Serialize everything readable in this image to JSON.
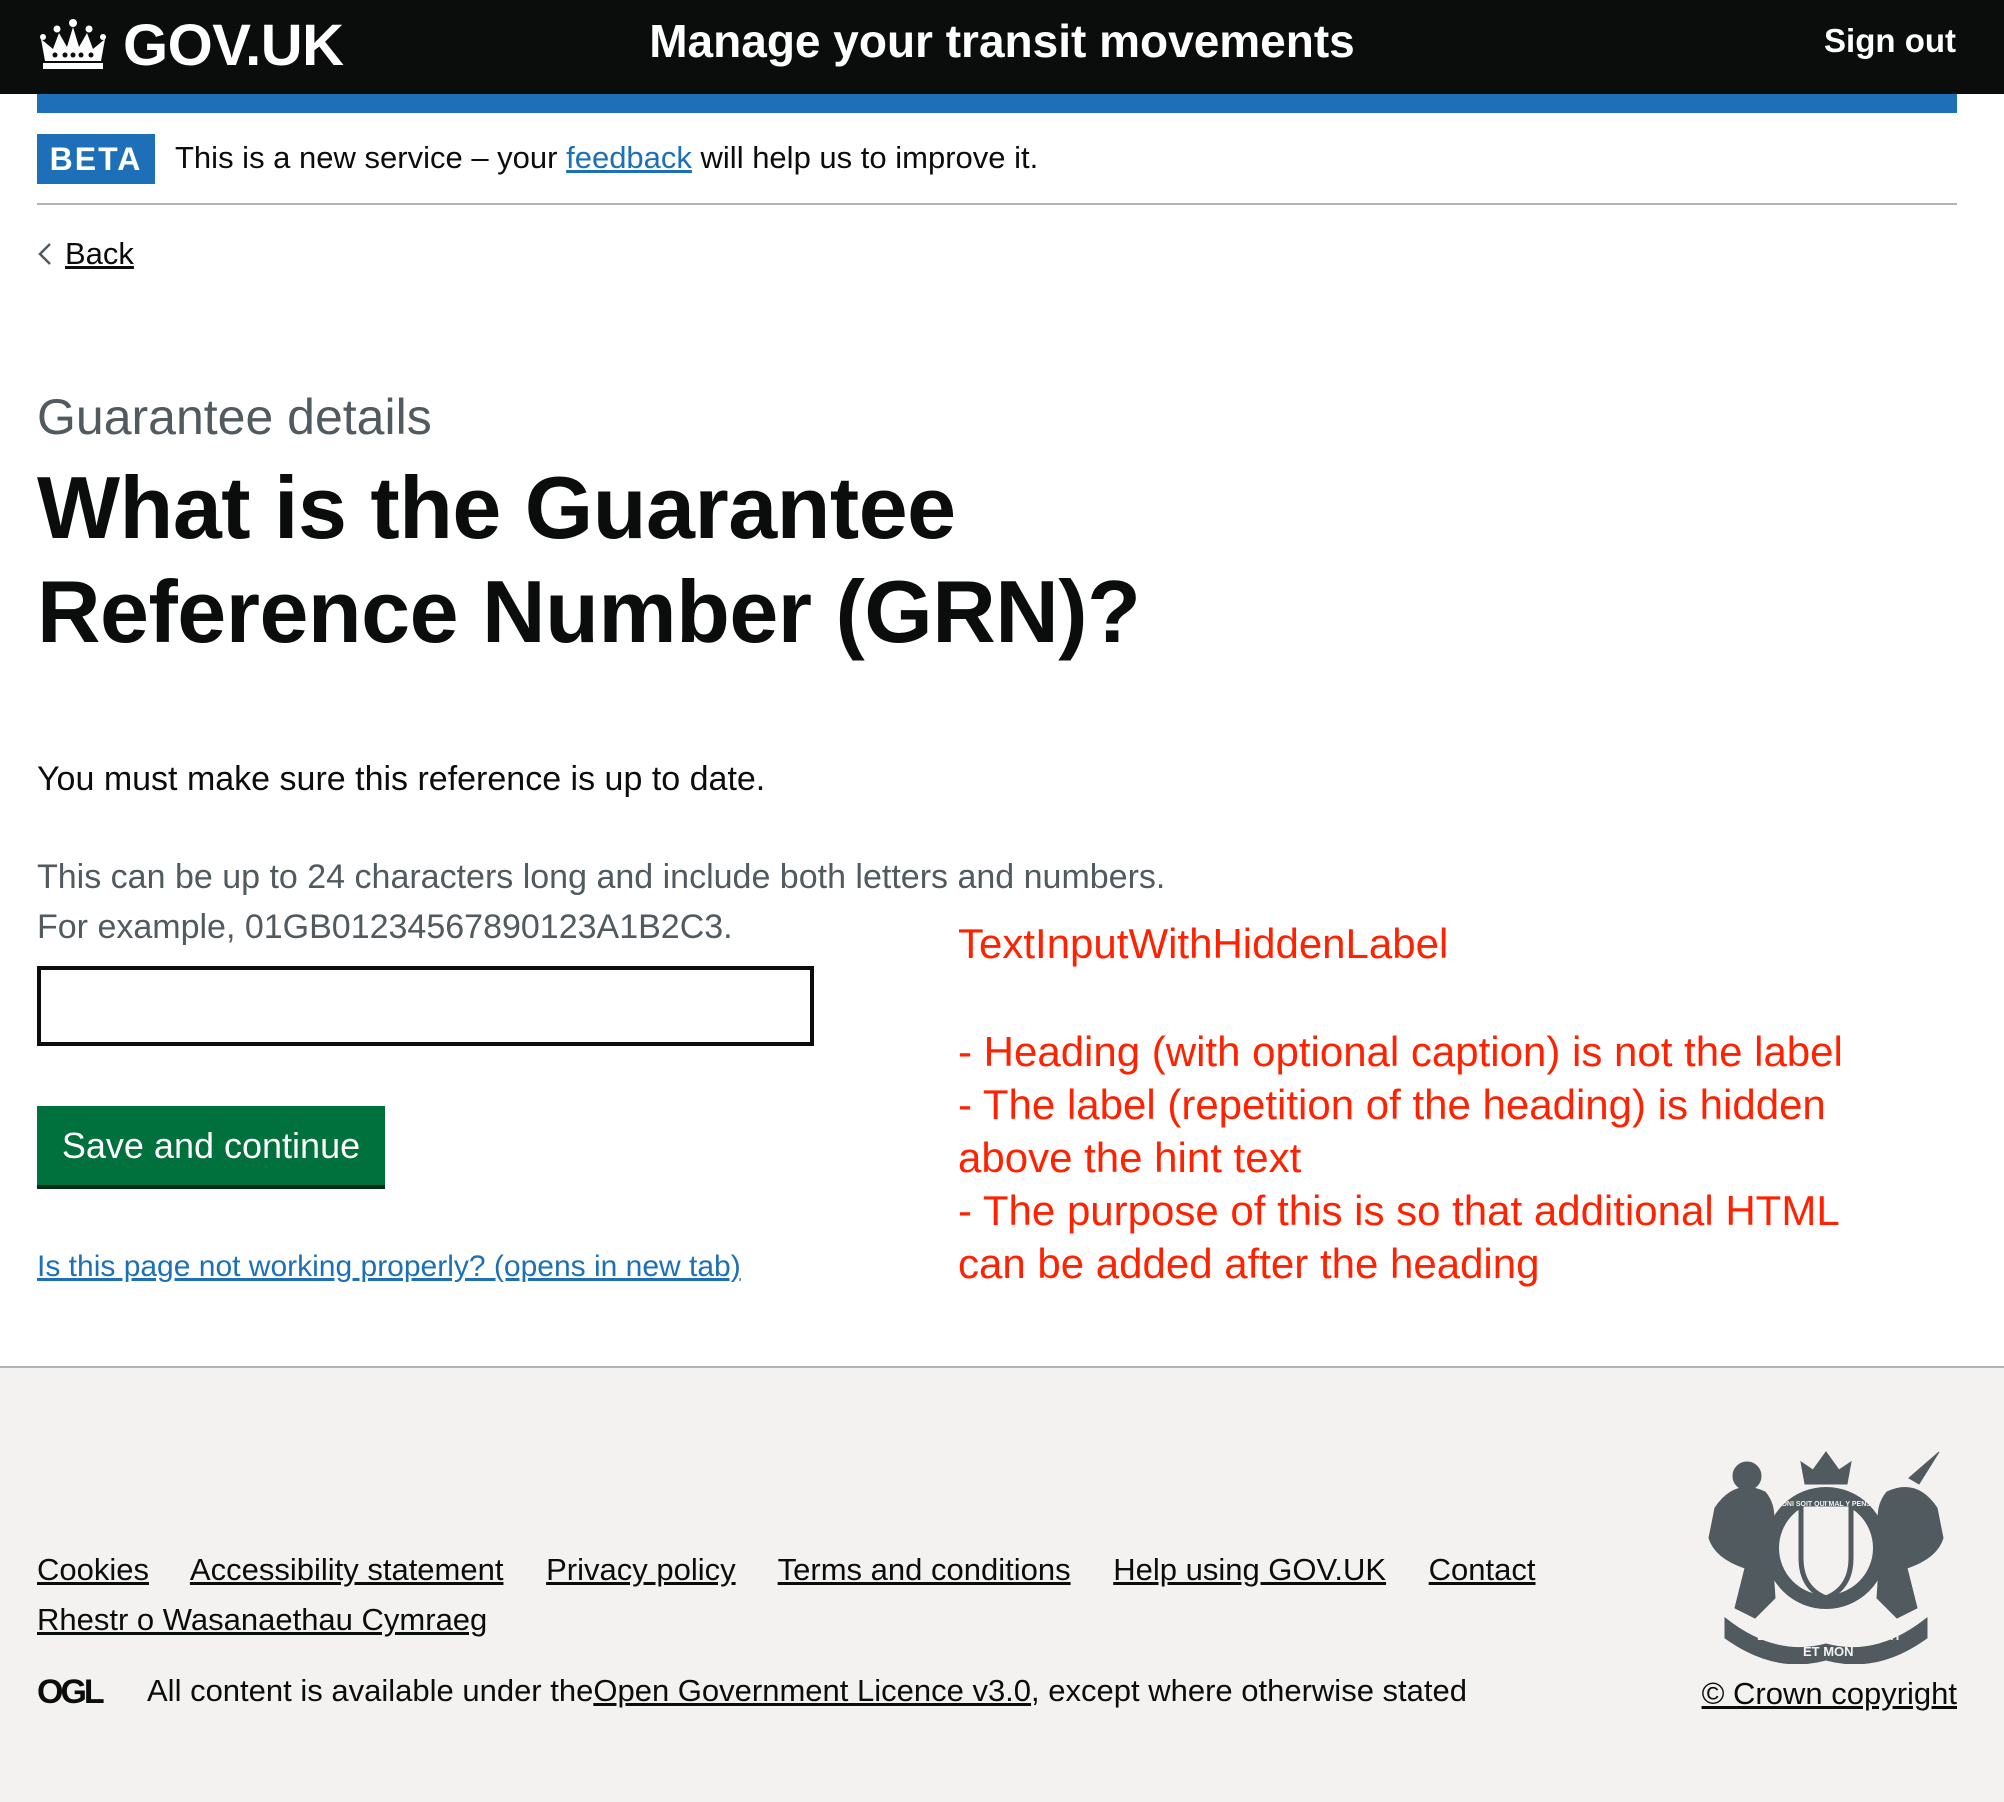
{
  "header": {
    "logo_text": "GOV.UK",
    "service_name": "Manage your transit movements",
    "sign_out": "Sign out"
  },
  "phase_banner": {
    "tag": "BETA",
    "text_before": "This is a new service – your ",
    "link_text": "feedback",
    "text_after": " will help us to improve it."
  },
  "back_link": "Back",
  "main": {
    "caption": "Guarantee details",
    "heading_line1": "What is the Guarantee",
    "heading_line2": "Reference Number (GRN)?",
    "body": "You must make sure this reference is up to date.",
    "hint_line1": "This can be up to 24 characters long and include both letters and numbers.",
    "hint_line2": "For example, 01GB01234567890123A1B2C3.",
    "input_value": "",
    "button": "Save and continue",
    "report_link": "Is this page not working properly? (opens in new tab)"
  },
  "annotation": {
    "title": "TextInputWithHiddenLabel",
    "line1": "- Heading (with optional caption) is not the label",
    "line2": "- The label (repetition of the heading) is hidden above the hint text",
    "line3": "- The purpose of this is so that additional HTML can be added after the heading"
  },
  "footer": {
    "links": [
      "Cookies",
      "Accessibility statement",
      "Privacy policy",
      "Terms and conditions",
      "Help using GOV.UK",
      "Contact",
      "Rhestr o Wasanaethau Cymraeg"
    ],
    "licence_before": "All content is available under the ",
    "licence_link": "Open Government Licence v3.0",
    "licence_after": ", except where otherwise stated",
    "copyright": "© Crown copyright",
    "ogl_text": "OGL",
    "crest_motto": [
      "DIEU",
      "ET MON",
      "DROIT",
      "HONI SOIT QUI MAL Y PENSE"
    ]
  },
  "colors": {
    "header_bg": "#0b0c0c",
    "brand_blue": "#1d70b8",
    "button_green": "#00703c",
    "annotation_red": "#ff2200",
    "footer_bg": "#f3f2f1"
  }
}
